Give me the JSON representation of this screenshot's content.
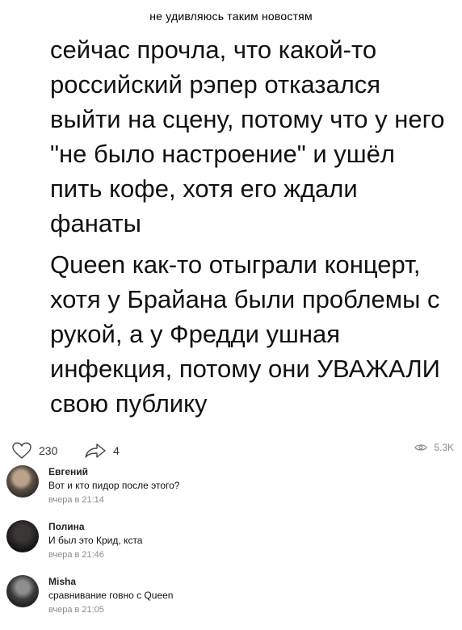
{
  "caption": "не удивляюсь таким новостям",
  "post": {
    "paragraphs": [
      "сейчас прочла, что какой-то российский рэпер отказался выйти на сцену, потому что у него \"не было настроение\" и ушёл пить кофе, хотя его ждали фанаты",
      "Queen как-то отыграли концерт, хотя у Брайана были проблемы с рукой, а у Фредди ушная инфекция, потому они УВАЖАЛИ свою публику"
    ]
  },
  "actions": {
    "likes": "230",
    "shares": "4",
    "views": "5.3K",
    "like_icon": "heart-icon",
    "share_icon": "share-arrow-icon",
    "views_icon": "eye-icon"
  },
  "comments": [
    {
      "name": "Евгений",
      "text": "Вот и кто пидор после этого?",
      "time": "вчера в 21:14"
    },
    {
      "name": "Полина",
      "text": "И был это Крид, кста",
      "time": "вчера в 21:46"
    },
    {
      "name": "Misha",
      "text": "сравнивание говно с Queen",
      "time": "вчера в 21:05"
    }
  ]
}
